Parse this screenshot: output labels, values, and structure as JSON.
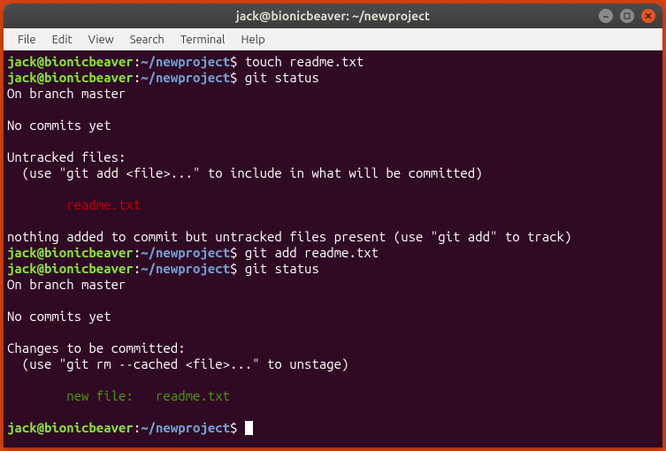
{
  "window": {
    "title": "jack@bionicbeaver: ~/newproject"
  },
  "menubar": {
    "items": [
      "File",
      "Edit",
      "View",
      "Search",
      "Terminal",
      "Help"
    ]
  },
  "prompt": {
    "userhost": "jack@bionicbeaver",
    "sep": ":",
    "path": "~/newproject",
    "symbol": "$"
  },
  "lines": [
    {
      "t": "prompt",
      "cmd": "touch readme.txt"
    },
    {
      "t": "prompt",
      "cmd": "git status"
    },
    {
      "t": "out",
      "text": "On branch master"
    },
    {
      "t": "blank"
    },
    {
      "t": "out",
      "text": "No commits yet"
    },
    {
      "t": "blank"
    },
    {
      "t": "out",
      "text": "Untracked files:"
    },
    {
      "t": "out",
      "text": "  (use \"git add <file>...\" to include in what will be committed)"
    },
    {
      "t": "blank"
    },
    {
      "t": "red",
      "text": "\treadme.txt"
    },
    {
      "t": "blank"
    },
    {
      "t": "out",
      "text": "nothing added to commit but untracked files present (use \"git add\" to track)"
    },
    {
      "t": "prompt",
      "cmd": "git add readme.txt"
    },
    {
      "t": "prompt",
      "cmd": "git status"
    },
    {
      "t": "out",
      "text": "On branch master"
    },
    {
      "t": "blank"
    },
    {
      "t": "out",
      "text": "No commits yet"
    },
    {
      "t": "blank"
    },
    {
      "t": "out",
      "text": "Changes to be committed:"
    },
    {
      "t": "out",
      "text": "  (use \"git rm --cached <file>...\" to unstage)"
    },
    {
      "t": "blank"
    },
    {
      "t": "green",
      "text": "\tnew file:   readme.txt"
    },
    {
      "t": "blank"
    },
    {
      "t": "prompt-cursor",
      "cmd": ""
    }
  ]
}
